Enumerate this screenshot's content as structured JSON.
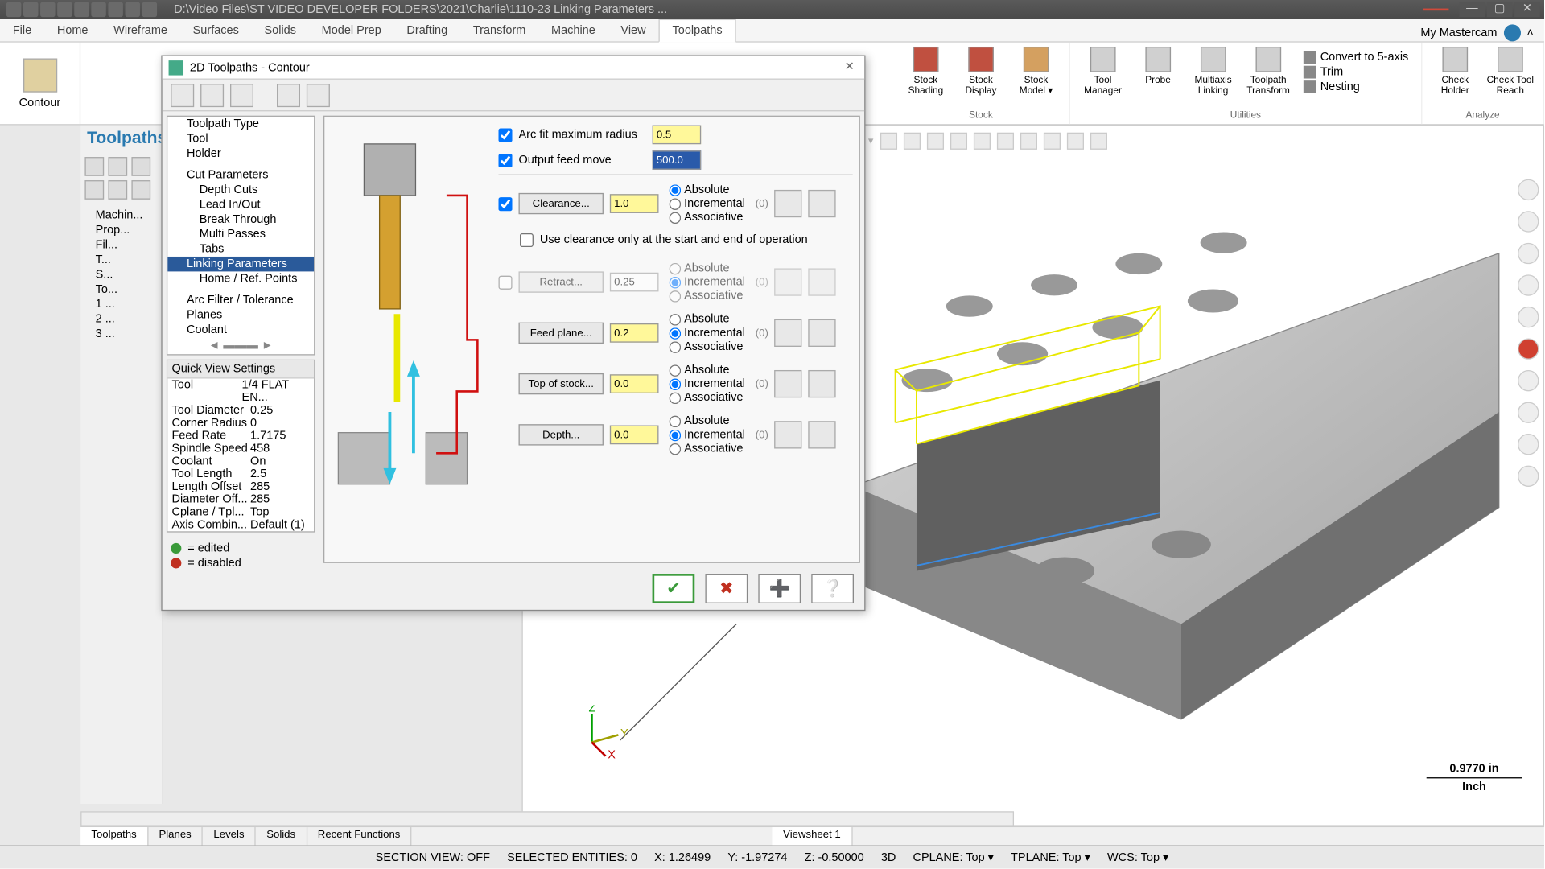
{
  "titlebar": {
    "path": "D:\\Video Files\\ST VIDEO DEVELOPER FOLDERS\\2021\\Charlie\\1110-23 Linking Parameters ...",
    "tag": ""
  },
  "ribbonTabs": [
    "File",
    "Home",
    "Wireframe",
    "Surfaces",
    "Solids",
    "Model Prep",
    "Drafting",
    "Transform",
    "Machine",
    "View",
    "Toolpaths"
  ],
  "activeTab": "Toolpaths",
  "user": "My Mastercam",
  "contourBtn": "Contour",
  "ribbonGroups": {
    "stock": {
      "title": "Stock",
      "btns": [
        "Stock Shading",
        "Stock Display",
        "Stock Model ▾"
      ]
    },
    "utilities": {
      "title": "Utilities",
      "btns": [
        "Tool Manager",
        "Probe",
        "Multiaxis Linking",
        "Toolpath Transform"
      ],
      "links": [
        "Convert to 5-axis",
        "Trim",
        "Nesting"
      ]
    },
    "analyze": {
      "title": "Analyze",
      "btns": [
        "Check Holder",
        "Check Tool Reach"
      ]
    }
  },
  "toolpanel": {
    "title": "Toolpaths",
    "tree": [
      "Machin...",
      "Prop...",
      "Fil...",
      "T...",
      "S...",
      "To...",
      "1 ...",
      "2 ...",
      "3 ..."
    ]
  },
  "dialog": {
    "title": "2D Toolpaths - Contour",
    "tree": [
      "Toolpath Type",
      "Tool",
      "Holder",
      "",
      "Cut Parameters",
      "Depth Cuts",
      "Lead In/Out",
      "Break Through",
      "Multi Passes",
      "Tabs",
      "Linking Parameters",
      "Home / Ref. Points",
      "",
      "Arc Filter / Tolerance",
      "Planes",
      "Coolant"
    ],
    "selected": "Linking Parameters",
    "quickView": {
      "title": "Quick View Settings",
      "rows": [
        [
          "Tool",
          "1/4 FLAT EN..."
        ],
        [
          "Tool Diameter",
          "0.25"
        ],
        [
          "Corner Radius",
          "0"
        ],
        [
          "Feed Rate",
          "1.7175"
        ],
        [
          "Spindle Speed",
          "458"
        ],
        [
          "Coolant",
          "On"
        ],
        [
          "Tool Length",
          "2.5"
        ],
        [
          "Length Offset",
          "285"
        ],
        [
          "Diameter Off...",
          "285"
        ],
        [
          "Cplane / Tpl...",
          "Top"
        ],
        [
          "Axis Combin...",
          "Default (1)"
        ]
      ]
    },
    "legend": [
      [
        "✓",
        "= edited",
        "#3a9a3a"
      ],
      [
        "⊘",
        "= disabled",
        "#c03020"
      ]
    ],
    "params": {
      "arcFit": {
        "label": "Arc fit maximum radius",
        "value": "0.5",
        "checked": true
      },
      "outputFeed": {
        "label": "Output feed move",
        "value": "500.0",
        "checked": true
      },
      "clearance": {
        "label": "Clearance...",
        "value": "1.0",
        "checked": true,
        "mode": "Absolute",
        "useOnly": "Use clearance only at the start and end of operation",
        "useOnlyChecked": false
      },
      "retract": {
        "label": "Retract...",
        "value": "0.25",
        "checked": false,
        "mode": "Incremental"
      },
      "feedPlane": {
        "label": "Feed plane...",
        "value": "0.2",
        "mode": "Incremental"
      },
      "topStock": {
        "label": "Top of stock...",
        "value": "0.0",
        "mode": "Incremental"
      },
      "depth": {
        "label": "Depth...",
        "value": "0.0",
        "mode": "Incremental"
      },
      "modes": [
        "Absolute",
        "Incremental",
        "Associative"
      ],
      "zero": "(0)"
    }
  },
  "bottomTabs": [
    "Toolpaths",
    "Planes",
    "Levels",
    "Solids",
    "Recent Functions"
  ],
  "viewsheet": "Viewsheet 1",
  "scale": {
    "value": "0.9770 in",
    "unit": "Inch"
  },
  "status": {
    "section": "SECTION VIEW: OFF",
    "sel": "SELECTED ENTITIES: 0",
    "x": "X: 1.26499",
    "y": "Y: -1.97274",
    "z": "Z: -0.50000",
    "mode": "3D",
    "cplane": "CPLANE: Top ▾",
    "tplane": "TPLANE: Top ▾",
    "wcs": "WCS: Top ▾"
  }
}
